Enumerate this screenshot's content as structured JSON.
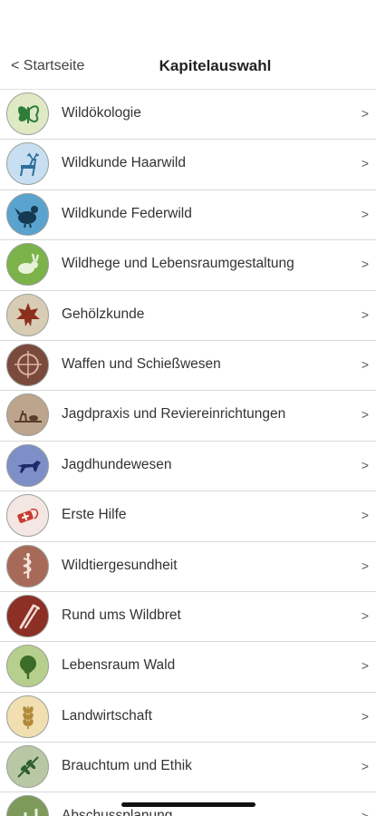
{
  "nav": {
    "back_label": "< Startseite",
    "title": "Kapitelauswahl"
  },
  "chevron": ">",
  "chapters": [
    {
      "label": "Wildökologie",
      "icon": "butterfly-icon",
      "bg": "#dfe9c4",
      "fg": "#2f7d3a"
    },
    {
      "label": "Wildkunde Haarwild",
      "icon": "deer-icon",
      "bg": "#c7dff0",
      "fg": "#2d6f9a"
    },
    {
      "label": "Wildkunde Federwild",
      "icon": "grouse-icon",
      "bg": "#5aa3cf",
      "fg": "#163a52"
    },
    {
      "label": "Wildhege und Lebensraumgestaltung",
      "icon": "hare-icon",
      "bg": "#7bb24a",
      "fg": "#e7f2d8"
    },
    {
      "label": "Gehölzkunde",
      "icon": "leaf-icon",
      "bg": "#d8ccb4",
      "fg": "#8b2f1b"
    },
    {
      "label": "Waffen und Schießwesen",
      "icon": "crosshair-icon",
      "bg": "#7a4a3c",
      "fg": "#d9b2a2"
    },
    {
      "label": "Jagdpraxis und Reviereinrichtungen",
      "icon": "hunting-scene-icon",
      "bg": "#bca58c",
      "fg": "#5a3d2b"
    },
    {
      "label": "Jagdhundewesen",
      "icon": "dog-icon",
      "bg": "#7e8fc8",
      "fg": "#1e2a6b"
    },
    {
      "label": "Erste Hilfe",
      "icon": "first-aid-icon",
      "bg": "#f4e6e2",
      "fg": "#c83a2f"
    },
    {
      "label": "Wildtiergesundheit",
      "icon": "caduceus-icon",
      "bg": "#a86a58",
      "fg": "#f3e4dd"
    },
    {
      "label": "Rund ums Wildbret",
      "icon": "knife-fork-icon",
      "bg": "#8c2f24",
      "fg": "#f1ddd4"
    },
    {
      "label": "Lebensraum Wald",
      "icon": "tree-icon",
      "bg": "#b7cf8d",
      "fg": "#3c6b2a"
    },
    {
      "label": "Landwirtschaft",
      "icon": "wheat-icon",
      "bg": "#f1dfb2",
      "fg": "#b08a3a"
    },
    {
      "label": "Brauchtum und Ethik",
      "icon": "twig-icon",
      "bg": "#b9c8a4",
      "fg": "#2f5e2f"
    },
    {
      "label": "Abschussplanung",
      "icon": "chart-icon",
      "bg": "#7e9a5a",
      "fg": "#e8f0d8"
    }
  ]
}
